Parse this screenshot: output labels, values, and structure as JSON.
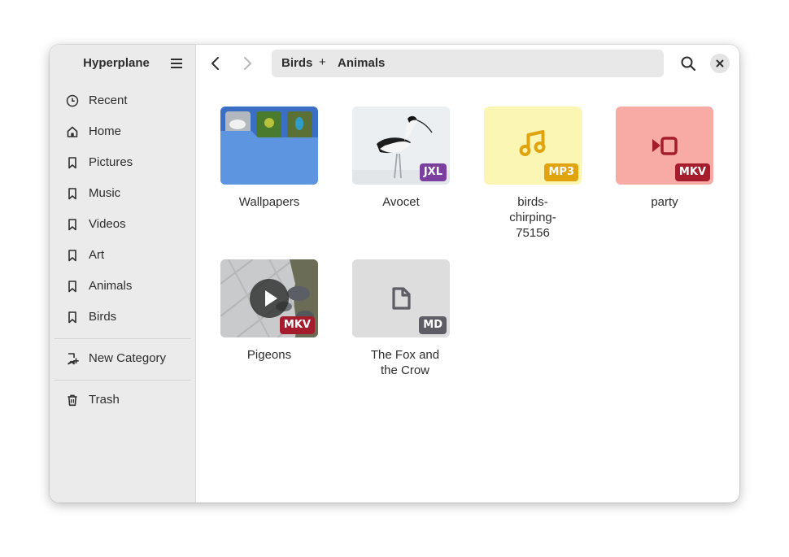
{
  "app": {
    "title": "Hyperplane"
  },
  "sidebar": {
    "items": [
      {
        "label": "Recent",
        "icon": "clock-icon"
      },
      {
        "label": "Home",
        "icon": "home-icon"
      },
      {
        "label": "Pictures",
        "icon": "bookmark-icon"
      },
      {
        "label": "Music",
        "icon": "bookmark-icon"
      },
      {
        "label": "Videos",
        "icon": "bookmark-icon"
      },
      {
        "label": "Art",
        "icon": "bookmark-icon"
      },
      {
        "label": "Animals",
        "icon": "bookmark-icon"
      },
      {
        "label": "Birds",
        "icon": "bookmark-icon"
      }
    ],
    "new_category": {
      "label": "New Category",
      "icon": "bookmark-add-icon"
    },
    "trash": {
      "label": "Trash",
      "icon": "trash-icon"
    }
  },
  "header": {
    "path": [
      {
        "label": "Birds"
      },
      {
        "label": "Animals"
      }
    ],
    "path_separator": "+"
  },
  "files": [
    {
      "name": "Wallpapers",
      "type": "folder"
    },
    {
      "name": "Avocet",
      "badge": "JXL",
      "badge_color": "#7b3fa0"
    },
    {
      "name": "birds-chirping-75156",
      "badge": "MP3",
      "badge_color": "#e0a40f",
      "bg": "#fbf6b4"
    },
    {
      "name": "party",
      "badge": "MKV",
      "badge_color": "#a51d2d",
      "bg": "#f8aaa4"
    },
    {
      "name": "Pigeons",
      "badge": "MKV",
      "badge_color": "#a51d2d"
    },
    {
      "name": "The Fox and the Crow",
      "badge": "MD",
      "badge_color": "#5e5c64",
      "bg": "#dedddd"
    }
  ],
  "colors": {
    "folder_blue": "#5e95e0",
    "accent": "#3584e4"
  }
}
